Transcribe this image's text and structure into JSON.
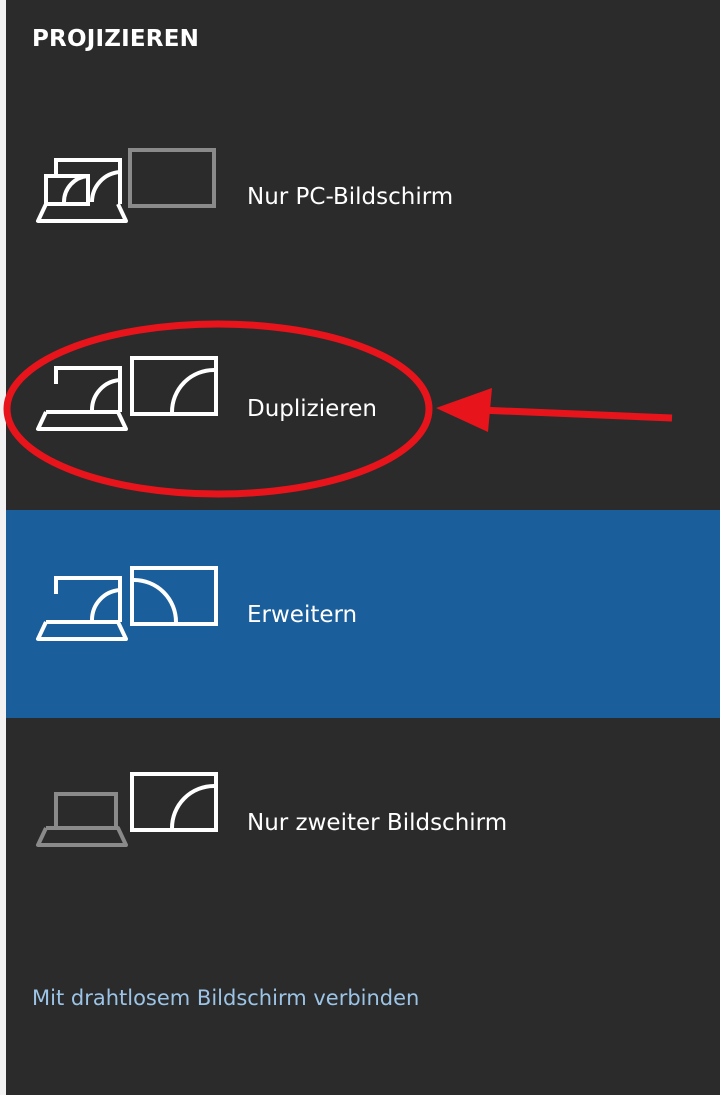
{
  "panel": {
    "title": "PROJIZIEREN",
    "options": [
      {
        "label": "Nur PC-Bildschirm",
        "icon": "pc-screen-only-icon",
        "selected": false
      },
      {
        "label": "Duplizieren",
        "icon": "duplicate-icon",
        "selected": false
      },
      {
        "label": "Erweitern",
        "icon": "extend-icon",
        "selected": true
      },
      {
        "label": "Nur zweiter Bildschirm",
        "icon": "second-screen-only-icon",
        "selected": false
      }
    ],
    "wireless_link": "Mit drahtlosem Bildschirm verbinden"
  },
  "colors": {
    "background": "#2b2b2b",
    "selected": "#1a5e9c",
    "link": "#9cc4e6",
    "dimmed_icon": "#8a8a8a",
    "annotation": "#e8141c"
  }
}
